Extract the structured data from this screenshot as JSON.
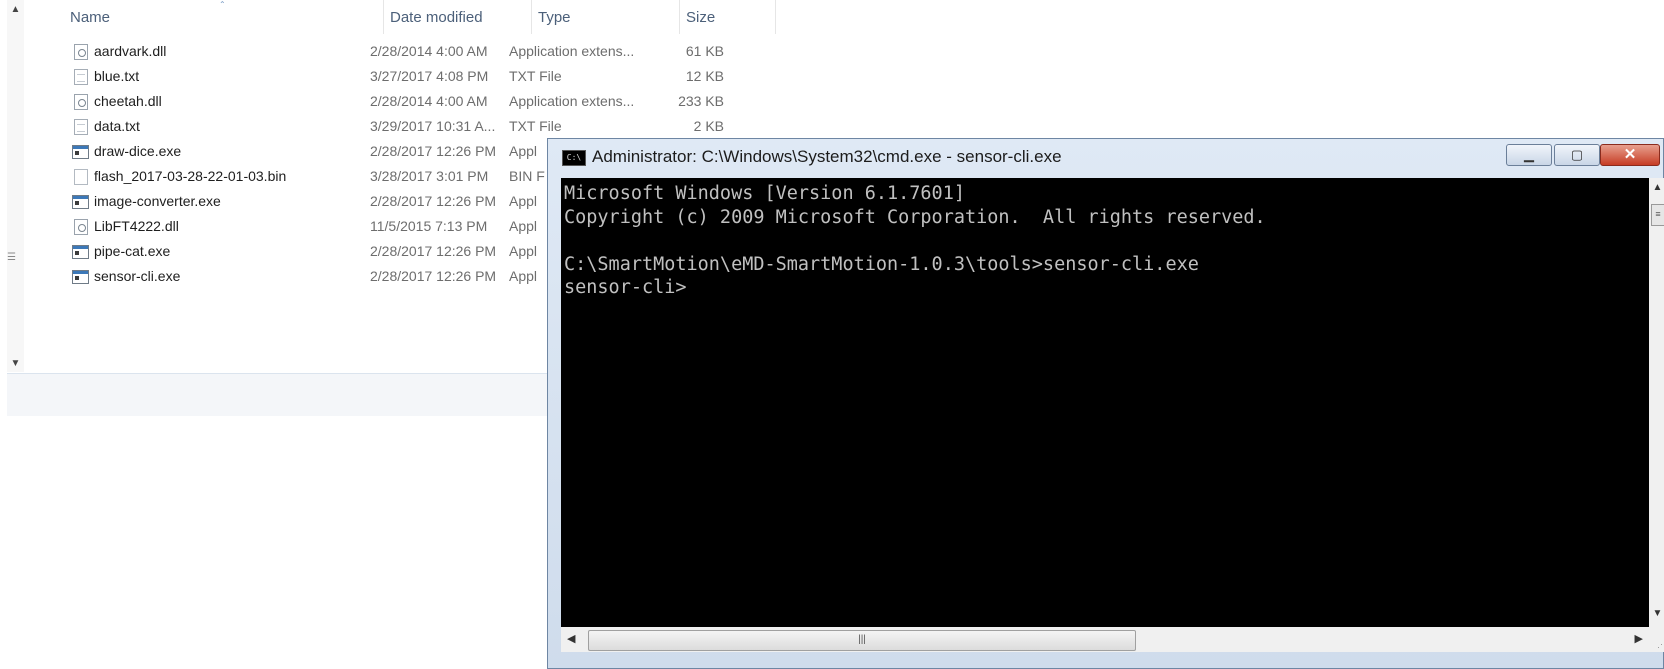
{
  "explorer": {
    "columns": {
      "name": "Name",
      "date": "Date modified",
      "type": "Type",
      "size": "Size"
    },
    "files": [
      {
        "name": "aardvark.dll",
        "date": "2/28/2014 4:00 AM",
        "type": "Application extens...",
        "size": "61 KB",
        "icon": "dll-file-icon"
      },
      {
        "name": "blue.txt",
        "date": "3/27/2017 4:08 PM",
        "type": "TXT File",
        "size": "12 KB",
        "icon": "text-file-icon"
      },
      {
        "name": "cheetah.dll",
        "date": "2/28/2014 4:00 AM",
        "type": "Application extens...",
        "size": "233 KB",
        "icon": "dll-file-icon"
      },
      {
        "name": "data.txt",
        "date": "3/29/2017 10:31 A...",
        "type": "TXT File",
        "size": "2 KB",
        "icon": "text-file-icon"
      },
      {
        "name": "draw-dice.exe",
        "date": "2/28/2017 12:26 PM",
        "type": "Appl",
        "size": "",
        "icon": "exe-file-icon"
      },
      {
        "name": "flash_2017-03-28-22-01-03.bin",
        "date": "3/28/2017 3:01 PM",
        "type": "BIN F",
        "size": "",
        "icon": "bin-file-icon"
      },
      {
        "name": "image-converter.exe",
        "date": "2/28/2017 12:26 PM",
        "type": "Appl",
        "size": "",
        "icon": "exe-file-icon"
      },
      {
        "name": "LibFT4222.dll",
        "date": "11/5/2015 7:13 PM",
        "type": "Appl",
        "size": "",
        "icon": "dll-file-icon"
      },
      {
        "name": "pipe-cat.exe",
        "date": "2/28/2017 12:26 PM",
        "type": "Appl",
        "size": "",
        "icon": "exe-file-icon"
      },
      {
        "name": "sensor-cli.exe",
        "date": "2/28/2017 12:26 PM",
        "type": "Appl",
        "size": "",
        "icon": "exe-file-icon"
      }
    ]
  },
  "cmd": {
    "app_icon_text": "C:\\",
    "title": "Administrator: C:\\Windows\\System32\\cmd.exe - sensor-cli.exe",
    "buttons": {
      "minimize": "▁",
      "maximize": "▢",
      "close": "✕"
    },
    "console_lines": [
      "Microsoft Windows [Version 6.1.7601]",
      "Copyright (c) 2009 Microsoft Corporation.  All rights reserved.",
      "",
      "C:\\SmartMotion\\eMD-SmartMotion-1.0.3\\tools>sensor-cli.exe",
      "sensor-cli>"
    ],
    "scroll_glyphs": {
      "up": "▲",
      "down": "▼",
      "left": "◀",
      "right": "▶",
      "grip": "|||"
    }
  }
}
